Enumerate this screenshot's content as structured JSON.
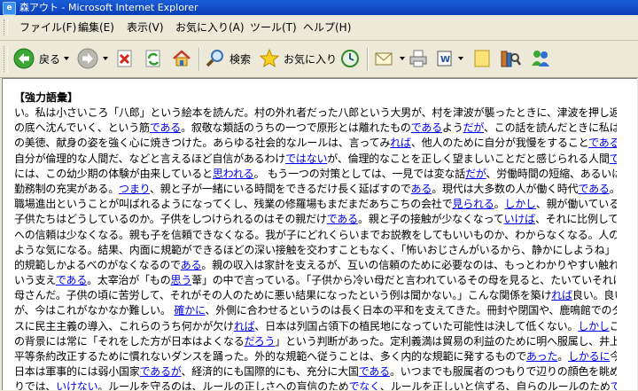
{
  "window": {
    "title": "森アウト - Microsoft Internet Explorer"
  },
  "menu": {
    "items": [
      "ファイル(F)",
      "編集(E)",
      "表示(V)",
      "お気に入り(A)",
      "ツール(T)",
      "ヘルプ(H)"
    ]
  },
  "toolbar": {
    "back_label": "戻る",
    "search_label": "検索",
    "favorites_label": "お気に入り"
  },
  "page": {
    "heading": "【強力語彙】",
    "lines": [
      [
        {
          "t": "い。私は小さいころ「八郎」という絵本を読んだ。村の外れ者だった八郎という大男が、村を津波が襲ったときに、津波を押し返しながら海"
        }
      ],
      [
        {
          "t": "の底へ沈んでいく、という筋"
        },
        {
          "t": "である",
          "a": 1
        },
        {
          "t": "。叙敬な類話のうちの一つで原形とは離れたもの"
        },
        {
          "t": "である",
          "a": 1
        },
        {
          "t": "よう"
        },
        {
          "t": "だが",
          "a": 1
        },
        {
          "t": "、この話を読んだときに私は自己犠牲"
        }
      ],
      [
        {
          "t": "の美徳、献身の姿を強く心に焼きつけた。あらゆる社会的なルールは、言ってみ"
        },
        {
          "t": "れば",
          "a": 1
        },
        {
          "t": "、他人のために自分が我慢をすること"
        },
        {
          "t": "である",
          "a": 1
        },
        {
          "t": "。私は"
        }
      ],
      [
        {
          "t": "自分が倫理的な人間だ、などと言えるほど自信があるわけ"
        },
        {
          "t": "ではない",
          "a": 1
        },
        {
          "t": "が、倫理的なことを正しく望ましいことだと感じられる人間"
        },
        {
          "t": "である",
          "a": 1
        },
        {
          "t": "こと"
        }
      ],
      [
        {
          "t": "には、この幼少期の体験が由来していると"
        },
        {
          "t": "思われる",
          "a": 1
        },
        {
          "t": "。 もう一つの対策としては、一見では変な話"
        },
        {
          "t": "だが",
          "a": 1
        },
        {
          "t": "、労働時間の短縮、あるいは自宅"
        }
      ],
      [
        {
          "t": "勤務制の充実がある。"
        },
        {
          "t": "つまり",
          "a": 1
        },
        {
          "t": "、親と子が一緒にいる時間をできるだけ長く延ばすので"
        },
        {
          "t": "ある",
          "a": 1
        },
        {
          "t": "。現代は大多数の人が働く時代"
        },
        {
          "t": "である",
          "a": 1
        },
        {
          "t": "。女性の"
        }
      ],
      [
        {
          "t": "職場進出ということが叫ばれるようになってくし、残業の修羅場もまだまだあちこちの会社で"
        },
        {
          "t": "見られる",
          "a": 1
        },
        {
          "t": "。"
        },
        {
          "t": "しかし",
          "a": 1
        },
        {
          "t": "、親が働いている時間、"
        }
      ],
      [
        {
          "t": "子供たちはどうしているのか。子供をしつけられるのはその親だけ"
        },
        {
          "t": "である",
          "a": 1
        },
        {
          "t": "。親と子の接触が少なくなって"
        },
        {
          "t": "いけば",
          "a": 1
        },
        {
          "t": "、それに比例して子の親"
        }
      ],
      [
        {
          "t": "への信頼は少なくなる。親も子を信頼できなくなる。我が子にどれくらいまでお説教をしてもいいものか、わからなくなる。人の子を見ている"
        }
      ],
      [
        {
          "t": "ような気になる。結果、内面に規範ができるほどの深い接触を交わすこともなく、「怖いおじさんがいるから、静かにしようね」といった外"
        }
      ],
      [
        {
          "t": "的規範しかよるべのがなくなるので"
        },
        {
          "t": "ある",
          "a": 1
        },
        {
          "t": "。親の収入は家計を支えるが、互いの信頼のために必要なのは、もっとわかりやすい触れ合いを"
        }
      ],
      [
        {
          "t": "いう支え"
        },
        {
          "t": "である",
          "a": 1
        },
        {
          "t": "。太宰治が「もの"
        },
        {
          "t": "思う",
          "a": 1
        },
        {
          "t": "葦」の中で言っている。「子供から冷い母だと言われているその母を見ると、たいていそれはいい"
        },
        {
          "t": "お",
          "a": 1
        }
      ],
      [
        {
          "t": "母さんだ。子供の頃に苦労して、それがその人のために悪い結果になったという例は聞かない。」こんな関係を築け"
        },
        {
          "t": "れば",
          "a": 1
        },
        {
          "t": "良い。良いの"
        },
        {
          "t": "だ",
          "a": 1
        }
      ],
      [
        {
          "t": "が、今はこれがなかなか難しい。 "
        },
        {
          "t": "確かに",
          "a": 1
        },
        {
          "t": "、外側に合わせるというのは長く日本の平和を支えてきた。冊封や閉国や、鹿鳴館でのダン"
        }
      ],
      [
        {
          "t": "スに民主主義の導入、これらのうち何かが欠け"
        },
        {
          "t": "れば",
          "a": 1
        },
        {
          "t": "、日本は列国占領下の植民地になっていた可能性は決して低くない。"
        },
        {
          "t": "しかし",
          "a": 1
        },
        {
          "t": "これら"
        }
      ],
      [
        {
          "t": "の背景には常に「それをした方が日本はよくなる"
        },
        {
          "t": "だろう",
          "a": 1
        },
        {
          "t": "」という判断があった。定利義満は貿易の利益のために明へ服属し、井上馨は不"
        }
      ],
      [
        {
          "t": "平等条約改正するために慣れないダンスを踊った。外的な規範へ従うことは、多く内的な規範に発するもので"
        },
        {
          "t": "あった",
          "a": 1
        },
        {
          "t": "。"
        },
        {
          "t": "しかるに",
          "a": 1
        },
        {
          "t": "今日、"
        }
      ],
      [
        {
          "t": "日本は軍事的には弱小国家"
        },
        {
          "t": "であるが",
          "a": 1
        },
        {
          "t": "、経済的にも国際的にも、充分に大国"
        },
        {
          "t": "である",
          "a": 1
        },
        {
          "t": "。いつまでも服属者のつもりで辺りの顔色を眺めばか"
        }
      ],
      [
        {
          "t": "りでは、"
        },
        {
          "t": "いけない",
          "a": 1
        },
        {
          "t": "。ルールを守るのは、ルールの正しさへの盲信のため"
        },
        {
          "t": "でなく",
          "a": 1
        },
        {
          "t": "、ルールを正しいと信ずる、自らのルールのため"
        },
        {
          "t": "である",
          "a": 1
        },
        {
          "t": "。"
        }
      ],
      [
        {
          "t": "外側に従う時に自らの内にあった道徳を、忘れては"
        },
        {
          "t": "いけない",
          "a": 1
        },
        {
          "t": "ので"
        },
        {
          "t": "ある",
          "a": 1
        },
        {
          "t": "。"
        }
      ]
    ]
  },
  "colors": {
    "link": "#0000ee",
    "titlebar": "#0a3db8",
    "chrome": "#ece9d8"
  }
}
